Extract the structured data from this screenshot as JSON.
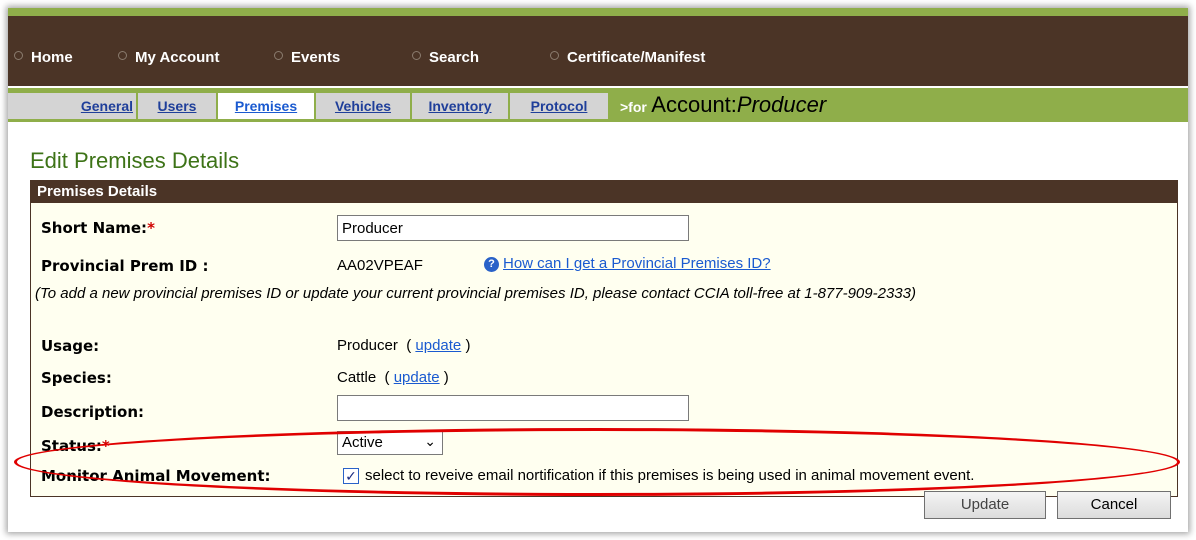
{
  "nav": {
    "items": [
      "Home",
      "My Account",
      "Events",
      "Search",
      "Certificate/Manifest"
    ]
  },
  "tabs": {
    "items": [
      "General",
      "Users",
      "Premises",
      "Vehicles",
      "Inventory",
      "Protocol"
    ],
    "active": "Premises",
    "suffix_for": ">for",
    "suffix_account": "Account:",
    "suffix_producer": "Producer"
  },
  "page": {
    "title": "Edit Premises Details"
  },
  "panel": {
    "header": "Premises Details",
    "short_name_label": "Short Name:",
    "required_mark": "*",
    "short_name_value": "Producer",
    "prov_prem_label": "Provincial Prem ID :",
    "prov_prem_value": "AA02VPEAF",
    "help_link": "How can I get a Provincial Premises ID?",
    "note": "(To add a new provincial premises ID or update your current provincial premises ID, please contact CCIA toll-free at 1-877-909-2333)",
    "usage_label": "Usage:",
    "usage_value": "Producer",
    "species_label": "Species:",
    "species_value": "Cattle",
    "update_link": "update",
    "paren_open": "(",
    "paren_close": ")",
    "description_label": "Description:",
    "description_value": "",
    "status_label": "Status:",
    "status_value": "Active",
    "monitor_label": "Monitor Animal Movement:",
    "monitor_checked": true,
    "monitor_text": "select to reveive email nortification if this premises is being used in animal movement event.",
    "update_button": "Update",
    "cancel_button": "Cancel"
  },
  "colors": {
    "nav_bg": "#4b3426",
    "tab_bar_bg": "#8fae4a",
    "title_green": "#3d7317",
    "link_blue": "#1a5ad0",
    "annotation_red": "#e00000"
  },
  "icons": {
    "help": "help-circle-icon",
    "nav_bullet": "circle-bullet-icon",
    "checkbox": "checkmark-icon"
  }
}
